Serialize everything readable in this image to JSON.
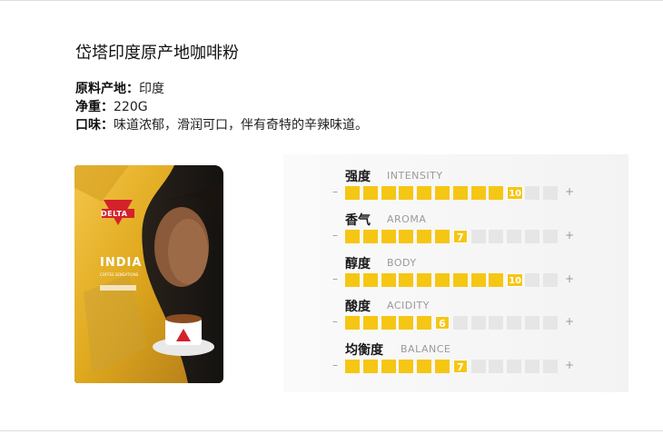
{
  "product": {
    "title": "岱塔印度原产地咖啡粉",
    "specs": [
      {
        "key": "原料产地：",
        "value": "印度"
      },
      {
        "key": "净重：",
        "value": "220G"
      },
      {
        "key": "口味：",
        "value": "味道浓郁，滑润可口，伴有奇特的辛辣味道。"
      }
    ],
    "package": {
      "brand": "DELTA",
      "origin": "INDIA",
      "subtitle": "COFFEE SENSATIONS"
    }
  },
  "ratings": {
    "max": 12,
    "minus_symbol": "–",
    "plus_symbol": "+",
    "filled_color": "#f6c614",
    "empty_color": "#e6e6e6",
    "items": [
      {
        "cn": "强度",
        "en": "INTENSITY",
        "value": 10,
        "value_label": "10"
      },
      {
        "cn": "香气",
        "en": "AROMA",
        "value": 7,
        "value_label": "7"
      },
      {
        "cn": "醇度",
        "en": "BODY",
        "value": 10,
        "value_label": "10"
      },
      {
        "cn": "酸度",
        "en": "ACIDITY",
        "value": 6,
        "value_label": "6"
      },
      {
        "cn": "均衡度",
        "en": "BALANCE",
        "value": 7,
        "value_label": "7"
      }
    ]
  }
}
